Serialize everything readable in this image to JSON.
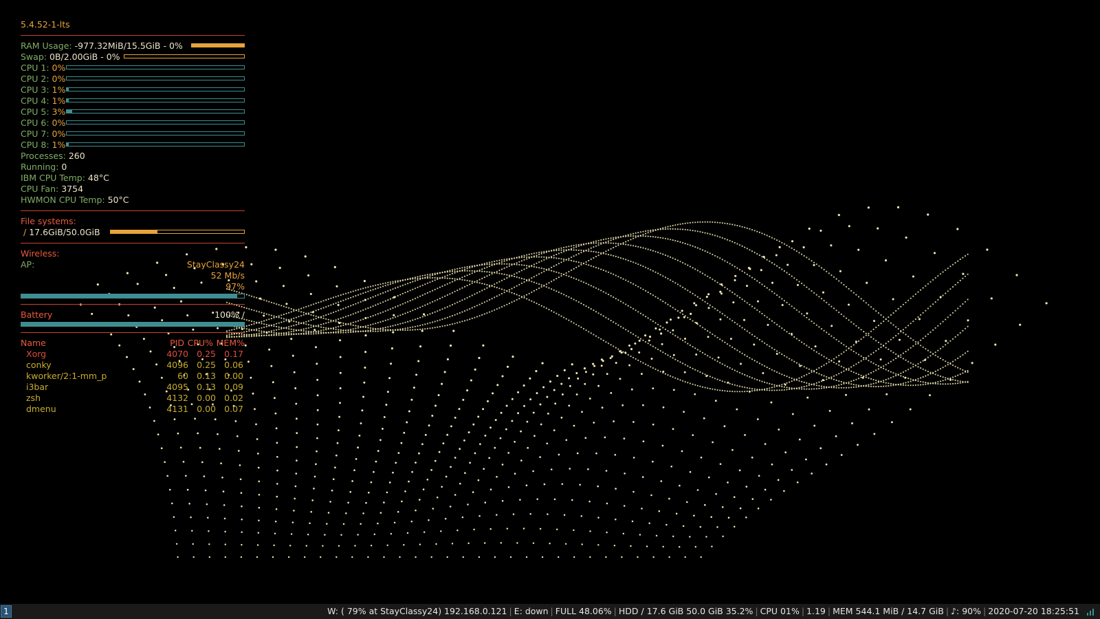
{
  "conky": {
    "kernel": "5.4.52-1-lts",
    "ram": {
      "label": "RAM Usage:",
      "value": "-977.32MiB/15.5GiB - 0%",
      "level": 100
    },
    "swap": {
      "label": "Swap:",
      "value": "0B/2.00GiB - 0%",
      "level": 0
    },
    "cpus": [
      {
        "label": "CPU 1:",
        "value": "0%",
        "level": 0
      },
      {
        "label": "CPU 2:",
        "value": "0%",
        "level": 0
      },
      {
        "label": "CPU 3:",
        "value": "1%",
        "level": 1
      },
      {
        "label": "CPU 4:",
        "value": "1%",
        "level": 1
      },
      {
        "label": "CPU 5:",
        "value": "3%",
        "level": 3
      },
      {
        "label": "CPU 6:",
        "value": "0%",
        "level": 0
      },
      {
        "label": "CPU 7:",
        "value": "0%",
        "level": 0
      },
      {
        "label": "CPU 8:",
        "value": "1%",
        "level": 1
      }
    ],
    "processes": {
      "label": "Processes:",
      "value": "260"
    },
    "running": {
      "label": "Running:",
      "value": "0"
    },
    "ibm_temp": {
      "label": "IBM CPU Temp:",
      "value": "48°C"
    },
    "fan": {
      "label": "CPU Fan:",
      "value": "3754"
    },
    "hwmon_temp": {
      "label": "HWMON CPU Temp:",
      "value": "50°C"
    },
    "fs": {
      "header": "File systems:",
      "mount": "/",
      "value": "17.6GiB/50.0GiB",
      "level": 35.2
    },
    "wireless": {
      "header": "Wireless:",
      "ap_label": "AP:",
      "ssid": "StayClassy24",
      "speed": "52 Mb/s",
      "quality": "97%",
      "level": 97
    },
    "battery": {
      "header": "Battery",
      "value": "100% /",
      "level": 100
    },
    "top": {
      "headers": {
        "name": "Name",
        "pid": "PID",
        "cpu": "CPU%",
        "mem": "MEM%"
      },
      "rows": [
        {
          "name": "Xorg",
          "pid": "4070",
          "cpu": "0.25",
          "mem": "0.17"
        },
        {
          "name": "conky",
          "pid": "4096",
          "cpu": "0.25",
          "mem": "0.06"
        },
        {
          "name": "kworker/2:1-mm_p",
          "pid": "60",
          "cpu": "0.13",
          "mem": "0.00"
        },
        {
          "name": "i3bar",
          "pid": "4095",
          "cpu": "0.13",
          "mem": "0.09"
        },
        {
          "name": "zsh",
          "pid": "4132",
          "cpu": "0.00",
          "mem": "0.02"
        },
        {
          "name": "dmenu",
          "pid": "4131",
          "cpu": "0.00",
          "mem": "0.07"
        }
      ]
    }
  },
  "taskbar": {
    "workspace": "1",
    "segments": [
      "W: ( 79% at StayClassy24) 192.168.0.121",
      "E: down",
      "FULL 48.06%",
      "HDD / 17.6 GiB 50.0 GiB 35.2%",
      "CPU 01%",
      "1.19",
      "MEM 544.1 MiB / 14.7 GiB",
      "♪: 90%",
      "2020-07-20 18:25:51"
    ]
  },
  "colors": {
    "background": "#000000",
    "dots": "#efe6b4",
    "label": "#7fae63",
    "accent": "#e8a33a",
    "header": "#ea5a3c",
    "teal": "#3f8f92"
  }
}
